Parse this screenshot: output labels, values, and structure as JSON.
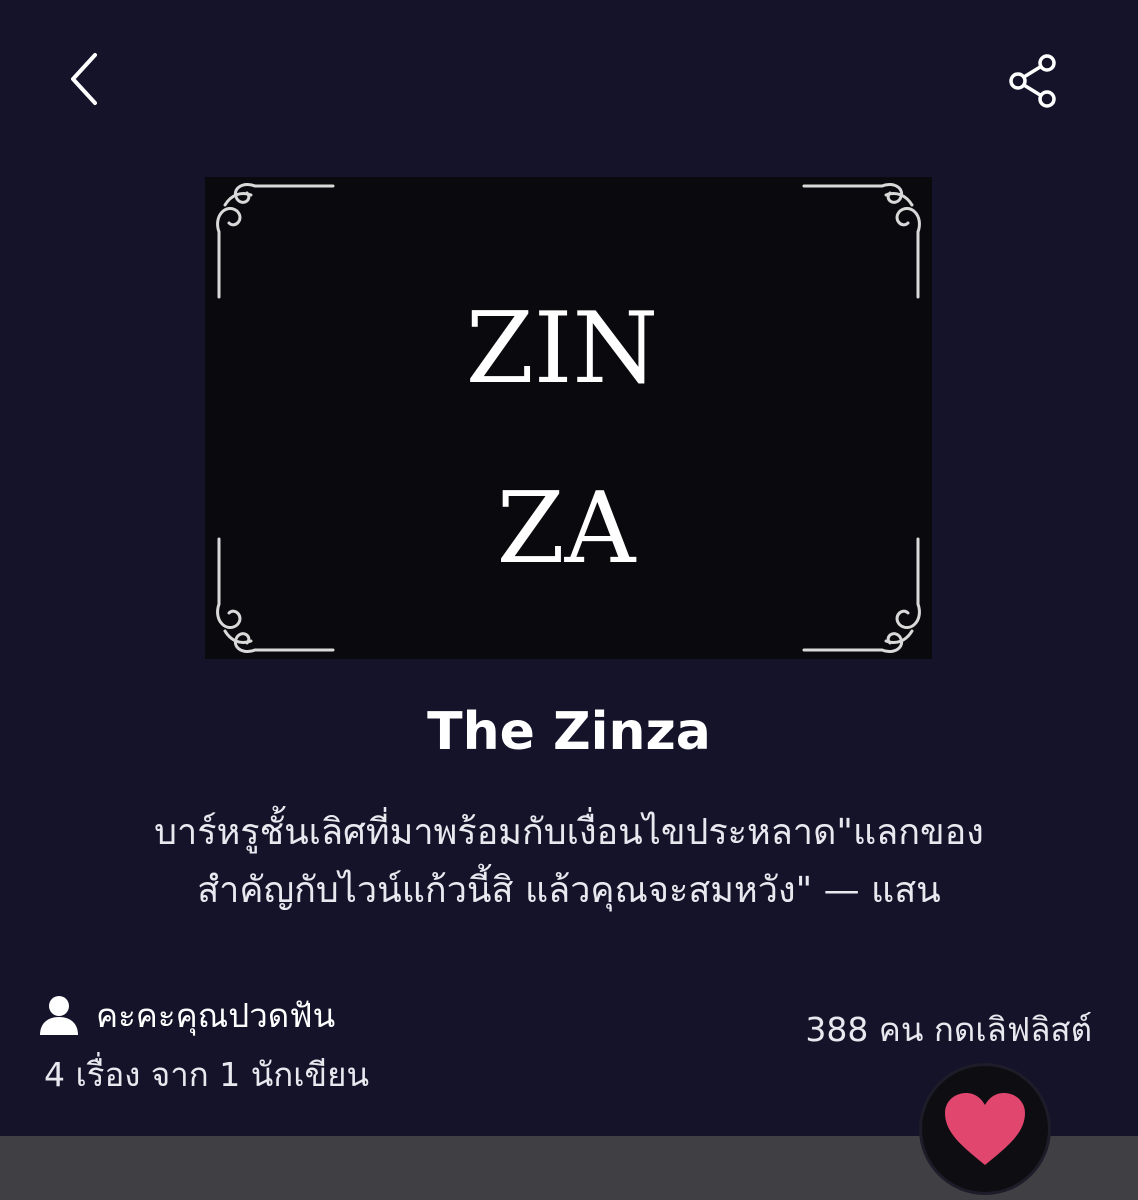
{
  "header": {
    "back_icon": "chevron-left-icon",
    "share_icon": "share-icon"
  },
  "cover": {
    "line1": "ZIN",
    "line2": "ZA"
  },
  "title": "The Zinza",
  "synopsis": {
    "line1": "บาร์หรูชั้นเลิศที่มาพร้อมกับเงื่อนไขประหลาด\"แลกของ",
    "line2": "สำคัญกับไวน์แก้วนี้สิ แล้วคุณจะสมหวัง\" — แสน"
  },
  "author": {
    "icon": "person-icon",
    "name": "คะคะคุณปวดฟัน"
  },
  "stats": "4 เรื่อง จาก 1 นักเขียน",
  "favorites": "388 คน กดเลิฟลิสต์",
  "fav_button": {
    "icon": "heart-icon",
    "color": "#e1466f"
  },
  "colors": {
    "background": "#15132a",
    "bottom_bar": "#3f3f44"
  }
}
